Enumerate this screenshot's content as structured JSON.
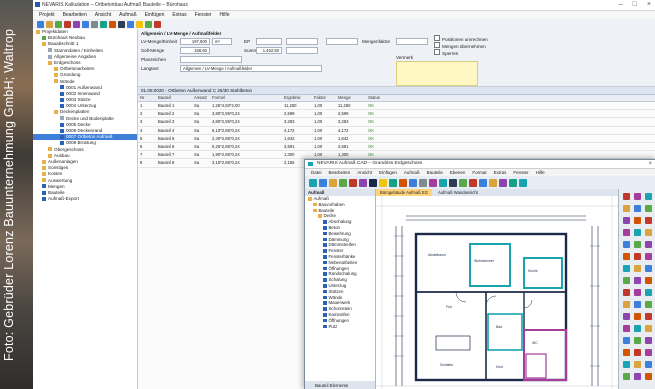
{
  "photo_credit": "Foto: Gebrüder Lorenz Bauunternehmung GmbH; Waltrop",
  "app": {
    "title": "NEVARIS Kalkulation – Ortbetonbau Aufmaß Bauteile – Bürohaus",
    "menu": [
      "Projekt",
      "Bearbeiten",
      "Ansicht",
      "Aufmaß",
      "Einfügen",
      "Extras",
      "Fenster",
      "Hilfe"
    ],
    "tree": [
      {
        "label": "Projektdaten",
        "level": 0,
        "icon": "folder-icon"
      },
      {
        "label": "Bürohaus Neubau",
        "level": 1,
        "icon": "project-icon"
      },
      {
        "label": "Bauabschnitt 1",
        "level": 1,
        "icon": "folder-icon"
      },
      {
        "label": "Stammdaten / Einheiten",
        "level": 2,
        "icon": "doc-icon"
      },
      {
        "label": "Allgemeine Angaben",
        "level": 2,
        "icon": "doc-icon"
      },
      {
        "label": "Erdgeschoss",
        "level": 2,
        "icon": "folder-icon"
      },
      {
        "label": "Ortbetonarbeiten",
        "level": 3,
        "icon": "folder-icon"
      },
      {
        "label": "Gründung",
        "level": 3,
        "icon": "folder-icon"
      },
      {
        "label": "Wände",
        "level": 3,
        "icon": "folder-icon"
      },
      {
        "label": "0001 Außenwand",
        "level": 4,
        "icon": "blue-item-icon"
      },
      {
        "label": "0002 Innenwand",
        "level": 4,
        "icon": "blue-item-icon"
      },
      {
        "label": "0003 Stütze",
        "level": 4,
        "icon": "blue-item-icon"
      },
      {
        "label": "0004 Unterzug",
        "level": 4,
        "icon": "blue-item-icon"
      },
      {
        "label": "Deckenplatten",
        "level": 3,
        "icon": "folder-icon"
      },
      {
        "label": "Decke und Bodenplatte",
        "level": 4,
        "icon": "doc-icon"
      },
      {
        "label": "0005 Decke",
        "level": 4,
        "icon": "blue-item-icon"
      },
      {
        "label": "0006 Deckenrand",
        "level": 4,
        "icon": "blue-item-icon"
      },
      {
        "label": "0007 Ortbeton Aufmaß",
        "level": 4,
        "icon": "blue-item-icon",
        "selected": true
      },
      {
        "label": "0008 Brüstung",
        "level": 4,
        "icon": "blue-item-icon"
      },
      {
        "label": "Obergeschoss",
        "level": 2,
        "icon": "folder-icon"
      },
      {
        "label": "Ausbau",
        "level": 2,
        "icon": "folder-icon"
      },
      {
        "label": "Außenanlagen",
        "level": 1,
        "icon": "folder-icon"
      },
      {
        "label": "Sonstiges",
        "level": 1,
        "icon": "folder-icon"
      },
      {
        "label": "Kosten",
        "level": 1,
        "icon": "folder-icon"
      },
      {
        "label": "Auswertung",
        "level": 1,
        "icon": "folder-icon"
      },
      {
        "label": "Mengen",
        "level": 1,
        "icon": "blue-item-icon"
      },
      {
        "label": "Bauteile",
        "level": 1,
        "icon": "blue-item-icon"
      },
      {
        "label": "Aufmaß-Export",
        "level": 1,
        "icon": "blue-item-icon"
      }
    ],
    "form": {
      "title": "Allgemein / LV-Menge / Aufmaßfelder",
      "labels": [
        "LV-Menge/Einheit",
        "Soll-Menge",
        "Planzeichen",
        "Langtext",
        "EP",
        "Summe",
        "Mengenfaktor",
        "Vermerk"
      ],
      "values": [
        "197,500",
        "m²",
        "158,60",
        "1.452,50"
      ],
      "checks": [
        "Positionen umrechnen",
        "Mengen übernehmen",
        "Sperren"
      ]
    },
    "grid": {
      "title": "01.08.0020 - Ortbeton Außenwand C 25/30 Stahlbeton",
      "columns": [
        "Nr",
        "Bauteil",
        "Ansatz",
        "Formel",
        "Ergebnis",
        "Faktor",
        "Menge",
        "Status"
      ],
      "rows": [
        [
          "1",
          "Bauteil 1",
          "Sa",
          "1,25*4,50*2,00",
          "11,250",
          "1,00",
          "11,250",
          "OK"
        ],
        [
          "2",
          "Bauteil 2",
          "Sa",
          "3,80*2,85*0,24",
          "2,599",
          "1,00",
          "2,599",
          "OK"
        ],
        [
          "3",
          "Bauteil 3",
          "Sa",
          "4,80*2,85*0,24",
          "3,283",
          "1,00",
          "3,283",
          "OK"
        ],
        [
          "4",
          "Bauteil 4",
          "Sa",
          "6,10*2,85*0,24",
          "4,172",
          "1,00",
          "4,172",
          "OK"
        ],
        [
          "5",
          "Bauteil 5",
          "Sa",
          "2,40*2,85*0,24",
          "1,642",
          "1,00",
          "1,642",
          "OK"
        ],
        [
          "6",
          "Bauteil 6",
          "Sa",
          "5,25*2,85*0,24",
          "3,591",
          "1,00",
          "3,591",
          "OK"
        ],
        [
          "7",
          "Bauteil 7",
          "Sa",
          "1,90*2,85*0,24",
          "1,300",
          "1,00",
          "1,300",
          "OK"
        ],
        [
          "8",
          "Bauteil 8",
          "Sa",
          "3,15*2,85*0,24",
          "2,155",
          "1,00",
          "2,155",
          "OK"
        ]
      ]
    }
  },
  "cad": {
    "title": "NEVARIS Aufmaß CAD – Grundriss Erdgeschoss",
    "menu": [
      "Datei",
      "Bearbeiten",
      "Ansicht",
      "Einfügen",
      "Aufmaß",
      "Bauteile",
      "Ebenen",
      "Format",
      "Extras",
      "Fenster",
      "Hilfe"
    ],
    "tabs": [
      "Bürogebäude Aufmaß EG",
      "Aufmaß Wandansicht"
    ],
    "panel_header": "Aufmaß",
    "tree": [
      "Aufmaß",
      "Bauvorhaben",
      "Bauteile",
      "Decke",
      "Abschalung",
      "Beton",
      "Bewehrung",
      "Dämmung",
      "Dämmstreifen",
      "Fenster",
      "Fensterbänke",
      "Nebenarbeiten",
      "Öffnungen",
      "Randschalung",
      "Schalung",
      "Unterzug",
      "Stützen",
      "Wände",
      "Mauerwerk",
      "Schornstein",
      "Kaminöfen",
      "Öffnungen",
      "Putz"
    ],
    "panel_footer": "Bauteil Elemente",
    "room_labels": [
      "Wohnzimmer",
      "Küche",
      "Bad",
      "Flur",
      "Schlafen",
      "Kind",
      "WC",
      "Abstellraum"
    ],
    "accent_color": "#1aa3b0",
    "wall_color": "#1c2a4a",
    "highlight_color": "#a43d9b"
  }
}
